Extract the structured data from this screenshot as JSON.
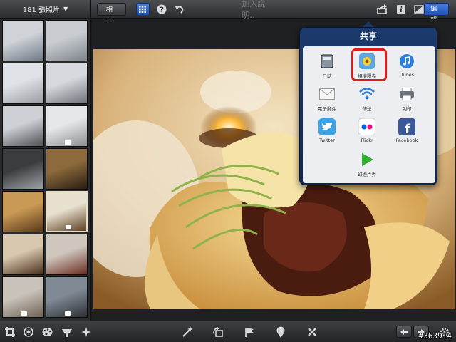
{
  "sidebar": {
    "photo_count_label": "181 張照片",
    "thumbnails": [
      {
        "colors": [
          "#cfd2d6",
          "#6f7a86"
        ],
        "badge": false
      },
      {
        "colors": [
          "#c8ccd0",
          "#7e858c"
        ],
        "badge": false
      },
      {
        "colors": [
          "#dfe2e6",
          "#9a9ea2"
        ],
        "badge": false
      },
      {
        "colors": [
          "#d6d9dd",
          "#6f747a"
        ],
        "badge": false
      },
      {
        "colors": [
          "#cdd0d4",
          "#4c4f53"
        ],
        "badge": false
      },
      {
        "colors": [
          "#e6e7e9",
          "#8c8f93"
        ],
        "badge": true
      },
      {
        "colors": [
          "#3a3c3f",
          "#9fa4a8"
        ],
        "badge": false
      },
      {
        "colors": [
          "#8c6a3c",
          "#2a1d12"
        ],
        "badge": false
      },
      {
        "colors": [
          "#c99a55",
          "#5a3819"
        ],
        "badge": false
      },
      {
        "colors": [
          "#e8e1cf",
          "#5c3e20"
        ],
        "badge": true,
        "selected": true
      },
      {
        "colors": [
          "#d9c8b0",
          "#4a2f1c"
        ],
        "badge": false
      },
      {
        "colors": [
          "#cfc7bd",
          "#6b2d22"
        ],
        "badge": false
      },
      {
        "colors": [
          "#c9c3bb",
          "#6e6255"
        ],
        "badge": true
      },
      {
        "colors": [
          "#7f8a95",
          "#2c2f33"
        ],
        "badge": true
      }
    ]
  },
  "topbar": {
    "back_label": "相簿",
    "caption_placeholder": "加入說明…",
    "edit_label": "編輯"
  },
  "share": {
    "title": "共享",
    "items": [
      {
        "label": "日誌",
        "icon": "journal-icon",
        "color": "#3b3f46"
      },
      {
        "label": "相機膠卷",
        "icon": "camera-roll-icon",
        "color": "#ffcc33"
      },
      {
        "label": "iTunes",
        "icon": "itunes-icon",
        "color": "#2a7ee0"
      },
      {
        "label": "電子郵件",
        "icon": "email-icon",
        "color": "#f2f2f2"
      },
      {
        "label": "傳送",
        "icon": "wifi-icon",
        "color": "#eceef2"
      },
      {
        "label": "列印",
        "icon": "printer-icon",
        "color": "#eceef2"
      },
      {
        "label": "Twitter",
        "icon": "twitter-icon",
        "color": "#3ba3e6"
      },
      {
        "label": "Flickr",
        "icon": "flickr-icon",
        "color": "#ffffff"
      },
      {
        "label": "Facebook",
        "icon": "facebook-icon",
        "color": "#3b5998"
      },
      {
        "label": "幻燈片秀",
        "icon": "play-icon",
        "color": "#eceef2"
      }
    ]
  },
  "watermark": "#363914",
  "colors": {
    "accent_blue": "#2a5fc8",
    "highlight_red": "#e21b1b"
  }
}
